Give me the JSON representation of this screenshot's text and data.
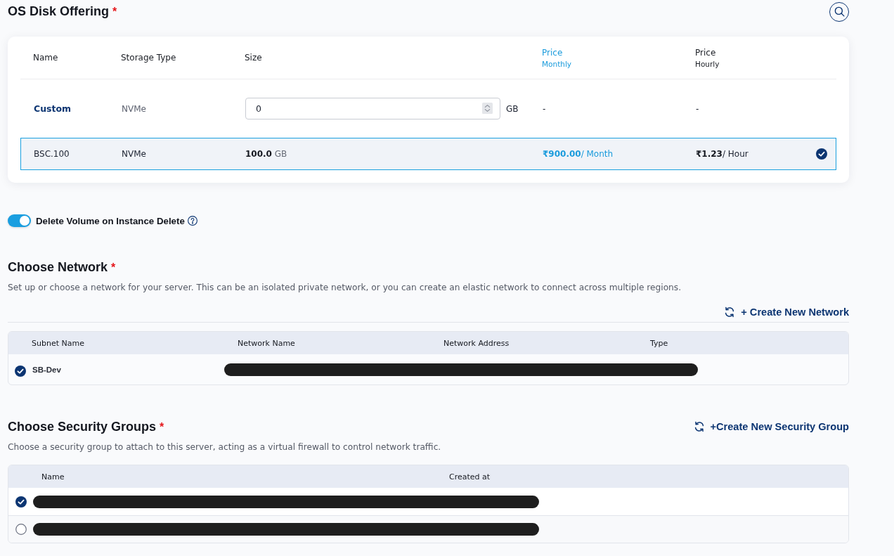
{
  "os_disk_offering": {
    "title": "OS Disk Offering",
    "required_mark": "*",
    "columns": [
      {
        "label": "Name",
        "highlighted": false
      },
      {
        "label": "Storage Type",
        "highlighted": false
      },
      {
        "label": "Size",
        "highlighted": false
      },
      {
        "label": "Price",
        "sublabel": "Monthly",
        "highlighted": true
      },
      {
        "label": "Price",
        "sublabel": "Hourly",
        "highlighted": false
      }
    ],
    "rows": [
      {
        "kind": "custom",
        "selected": false,
        "name": "Custom",
        "storage_type": "NVMe",
        "size_value": "0",
        "size_unit": "GB",
        "price_monthly": "-",
        "price_hourly": "-"
      },
      {
        "kind": "plan",
        "selected": true,
        "name": "BSC.100",
        "storage_type": "NVMe",
        "size": "**100.0** GB",
        "price_monthly": "**₹900.00**/ Month",
        "price_hourly": "**₹1.23**/ Hour"
      }
    ]
  },
  "delete_volume_toggle": {
    "label": "Delete Volume on Instance Delete",
    "on": true
  },
  "network": {
    "title": "Choose Network",
    "required_mark": "*",
    "description": "Set up or choose a network for your server. This can be an isolated private network, or you can create an elastic network to connect across multiple regions.",
    "create_link": "+ Create New Network",
    "columns": [
      "Subnet Name",
      "Network Name",
      "Network Address",
      "Type"
    ],
    "rows": [
      {
        "subnet_name": "SB-Dev",
        "selected": true
      }
    ]
  },
  "security_groups": {
    "title": "Choose Security Groups",
    "required_mark": "*",
    "create_link": "+Create New Security Group",
    "description": "Choose a security group to attach to this server, acting as a virtual firewall to control network traffic.",
    "columns": [
      "Name",
      "Created at"
    ],
    "rows": [
      {
        "selected": true
      },
      {
        "selected": false
      }
    ]
  }
}
